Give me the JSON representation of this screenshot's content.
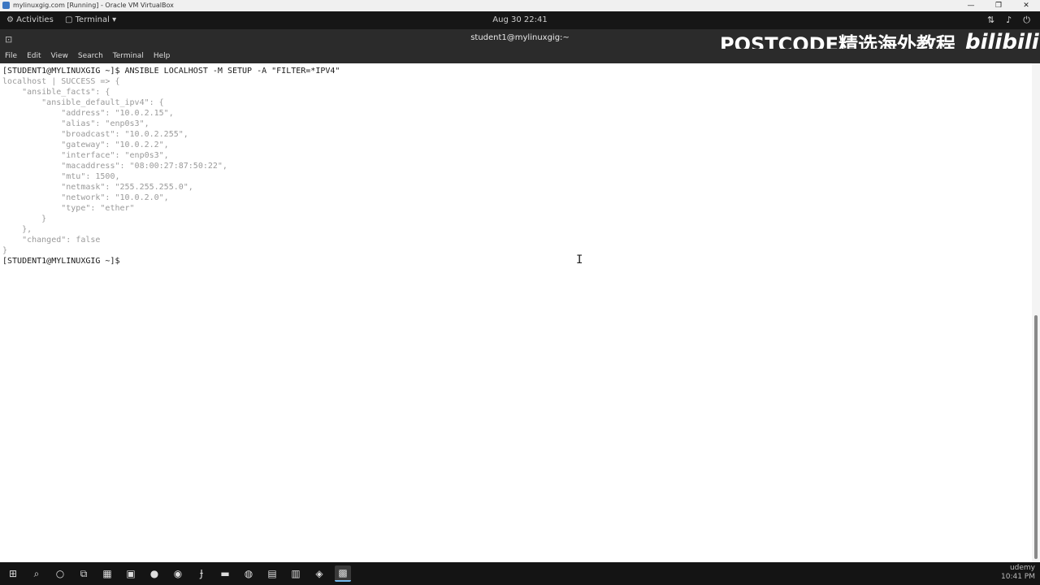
{
  "host_window": {
    "title": "mylinuxgig.com [Running] - Oracle VM VirtualBox",
    "controls": [
      "—",
      "❐",
      "✕"
    ]
  },
  "gnome_bar": {
    "activities": "Activities",
    "terminal_menu": "Terminal ▾",
    "clock": "Aug 30  22:41"
  },
  "terminal": {
    "window_title": "student1@mylinuxgig:~",
    "menu": [
      "File",
      "Edit",
      "View",
      "Search",
      "Terminal",
      "Help"
    ],
    "lines": [
      {
        "kind": "cmd",
        "text": "[STUDENT1@MYLINUXGIG ~]$ ANSIBLE LOCALHOST -M SETUP -A \"FILTER=*IPV4\""
      },
      {
        "kind": "out",
        "text": "localhost | SUCCESS => {"
      },
      {
        "kind": "out",
        "text": "    \"ansible_facts\": {"
      },
      {
        "kind": "out",
        "text": "        \"ansible_default_ipv4\": {"
      },
      {
        "kind": "out",
        "text": "            \"address\": \"10.0.2.15\","
      },
      {
        "kind": "out",
        "text": "            \"alias\": \"enp0s3\","
      },
      {
        "kind": "out",
        "text": "            \"broadcast\": \"10.0.2.255\","
      },
      {
        "kind": "out",
        "text": "            \"gateway\": \"10.0.2.2\","
      },
      {
        "kind": "out",
        "text": "            \"interface\": \"enp0s3\","
      },
      {
        "kind": "out",
        "text": "            \"macaddress\": \"08:00:27:87:50:22\","
      },
      {
        "kind": "out",
        "text": "            \"mtu\": 1500,"
      },
      {
        "kind": "out",
        "text": "            \"netmask\": \"255.255.255.0\","
      },
      {
        "kind": "out",
        "text": "            \"network\": \"10.0.2.0\","
      },
      {
        "kind": "out",
        "text": "            \"type\": \"ether\""
      },
      {
        "kind": "out",
        "text": "        }"
      },
      {
        "kind": "out",
        "text": "    },"
      },
      {
        "kind": "out",
        "text": "    \"changed\": false"
      },
      {
        "kind": "out",
        "text": "}"
      },
      {
        "kind": "cmd",
        "text": "[STUDENT1@MYLINUXGIG ~]$"
      }
    ]
  },
  "watermark": {
    "text": "POSTCODE精选海外教程",
    "logo": "bilibili"
  },
  "taskbar": {
    "tray_time": "10:41 PM",
    "tray_brand": "udemy"
  },
  "colors": {
    "terminal_bg": "#ffffff",
    "command_text": "#1a1a1a",
    "output_text": "#9a9a9a",
    "taskbar_bg": "#141414"
  }
}
